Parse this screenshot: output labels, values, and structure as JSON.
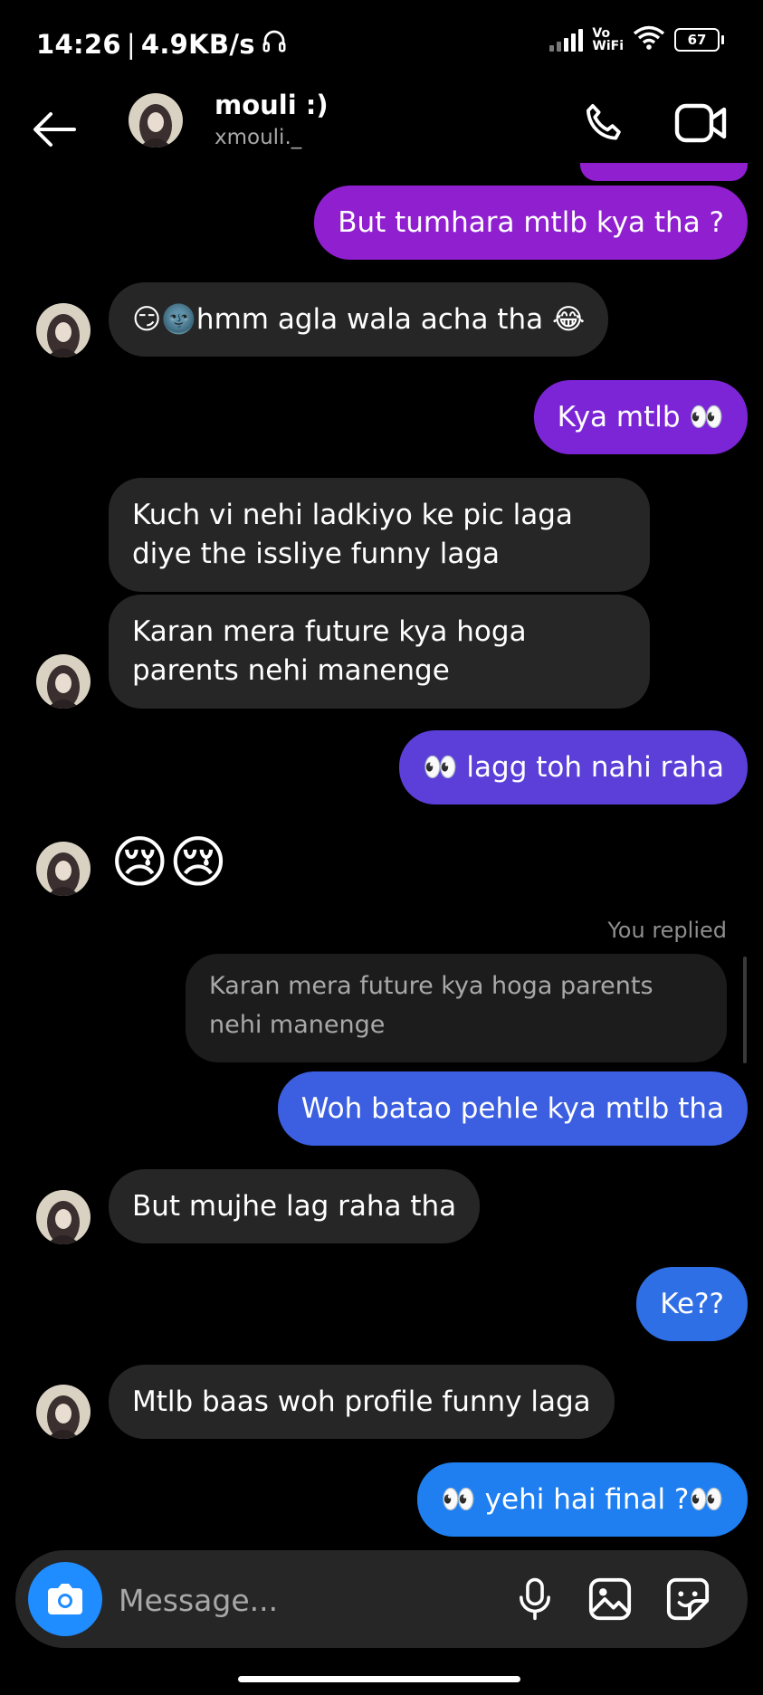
{
  "status_bar": {
    "time": "14:26",
    "net_speed": "4.9KB/s",
    "network_tag": "Vo WiFi",
    "network_tag_line1": "Vo",
    "network_tag_line2": "WiFi",
    "battery": "67"
  },
  "header": {
    "name": "mouli :)",
    "username": "xmouli._"
  },
  "messages": [
    {
      "side": "out",
      "text": "But tumhara mtlb kya tha ?",
      "color": "#8f1fcf"
    },
    {
      "side": "in",
      "text": "😏🌚hmm agla wala acha tha 😂"
    },
    {
      "side": "out",
      "text": "Kya mtlb 👀",
      "color": "#7c25d6"
    },
    {
      "side": "in",
      "text": "Kuch vi nehi ladkiyo ke pic laga diye the issliye funny laga"
    },
    {
      "side": "in",
      "text": "Karan mera future kya hoga parents nehi manenge"
    },
    {
      "side": "out",
      "text": "👀 lagg toh nahi raha",
      "color": "#5b3fd8"
    },
    {
      "side": "in",
      "text": "😢😢"
    },
    {
      "side": "out",
      "text": "Woh batao pehle kya mtlb tha",
      "color": "#3b5fe0"
    },
    {
      "side": "in",
      "text": "But mujhe lag raha tha"
    },
    {
      "side": "out",
      "text": "Ke??",
      "color": "#2f6fe6"
    },
    {
      "side": "in",
      "text": "Mtlb baas woh profile funny laga"
    },
    {
      "side": "out",
      "text": "👀 yehi hai final ?👀",
      "color": "#1f7ff0"
    }
  ],
  "reply": {
    "label": "You replied",
    "quoted": "Karan mera future kya hoga parents nehi manenge"
  },
  "composer": {
    "placeholder": "Message..."
  },
  "colors": {
    "background": "#000000",
    "incoming_bubble": "#262626",
    "camera_button": "#1f8cff"
  },
  "icons": [
    "back-arrow-icon",
    "phone-icon",
    "video-camera-icon",
    "camera-icon",
    "microphone-icon",
    "gallery-icon",
    "sticker-icon",
    "headphones-icon",
    "wifi-icon",
    "signal-icon",
    "battery-icon"
  ]
}
